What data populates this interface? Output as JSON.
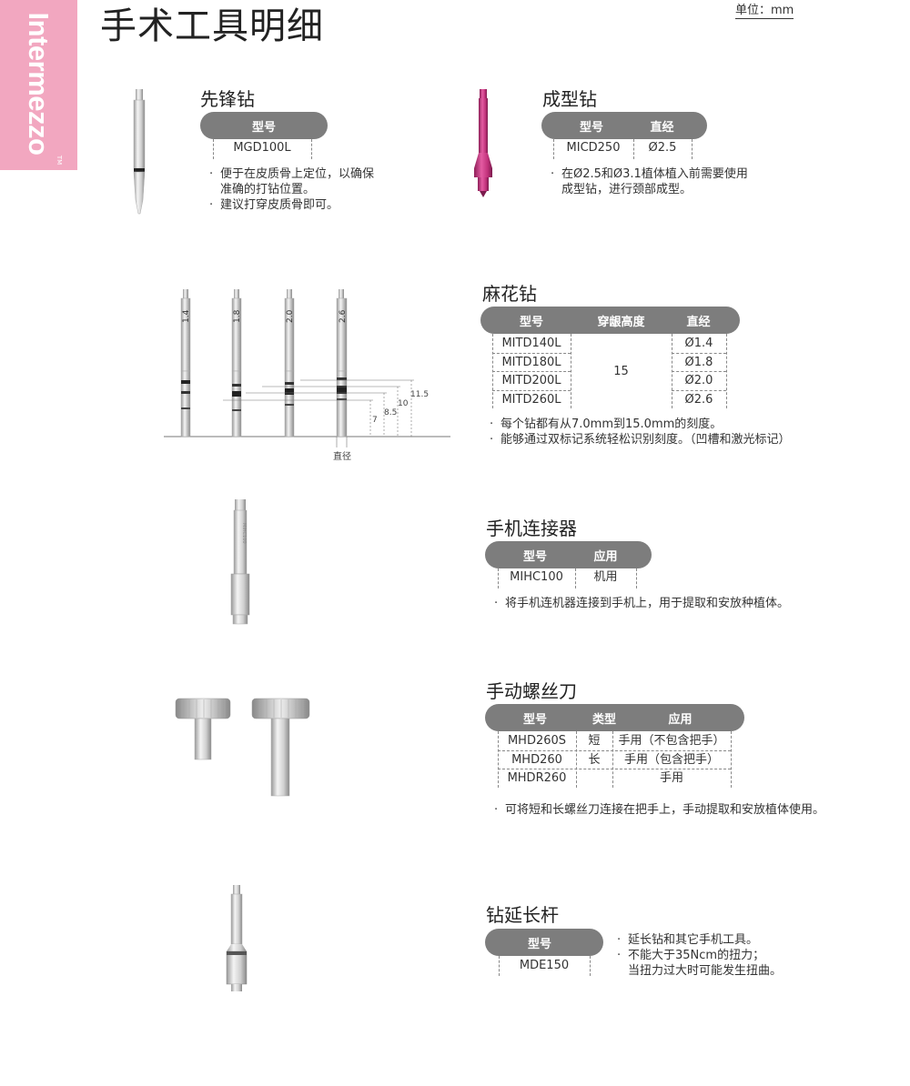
{
  "brand": {
    "logo": "Intermezzo",
    "tm": "TM",
    "color": "#f2a7c0"
  },
  "page_title": "手术工具明细",
  "unit": "单位：mm",
  "header_gray": "#7d7d7d",
  "sections": {
    "pilot": {
      "title": "先锋钻",
      "headers": [
        "型号"
      ],
      "model": "MGD100L",
      "notes": [
        "便于在皮质骨上定位，以确保",
        "准确的打钻位置。",
        "建议打穿皮质骨即可。"
      ]
    },
    "shaping": {
      "title": "成型钻",
      "headers": [
        "型号",
        "直经"
      ],
      "row": [
        "MICD250",
        "Ø2.5"
      ],
      "notes": [
        "在Ø2.5和Ø3.1植体植入前需要使用",
        "成型钻，进行颈部成型。"
      ],
      "color": "#c0317a"
    },
    "twist": {
      "title": "麻花钻",
      "headers": [
        "型号",
        "穿龈高度",
        "直经"
      ],
      "models": [
        "MITD140L",
        "MITD180L",
        "MITD200L",
        "MITD260L"
      ],
      "height": "15",
      "diameters": [
        "Ø1.4",
        "Ø1.8",
        "Ø2.0",
        "Ø2.6"
      ],
      "notes": [
        "每个钻都有从7.0mm到15.0mm的刻度。",
        "能够通过双标记系统轻松识别刻度。（凹槽和激光标记）"
      ],
      "drill_labels": [
        "1.4",
        "1.8",
        "2.0",
        "2.6"
      ],
      "dims": [
        "11.5",
        "10",
        "8.5",
        "7"
      ],
      "dia_label": "直径"
    },
    "handpiece": {
      "title": "手机连接器",
      "headers": [
        "型号",
        "应用"
      ],
      "row": [
        "MIHC100",
        "机用"
      ],
      "notes": [
        "将手机连机器连接到手机上，用于提取和安放种植体。"
      ]
    },
    "driver": {
      "title": "手动螺丝刀",
      "headers": [
        "型号",
        "类型",
        "应用"
      ],
      "rows": [
        [
          "MHD260S",
          "短",
          "手用（不包含把手）"
        ],
        [
          "MHD260",
          "长",
          "手用（包含把手）"
        ],
        [
          "MHDR260",
          "",
          "手用"
        ]
      ],
      "notes": [
        "可将短和长螺丝刀连接在把手上，手动提取和安放植体使用。"
      ]
    },
    "extension": {
      "title": "钻延长杆",
      "headers": [
        "型号"
      ],
      "model": "MDE150",
      "notes": [
        "延长钻和其它手机工具。",
        "不能大于35Ncm的扭力；",
        "当扭力过大时可能发生扭曲。"
      ]
    }
  }
}
